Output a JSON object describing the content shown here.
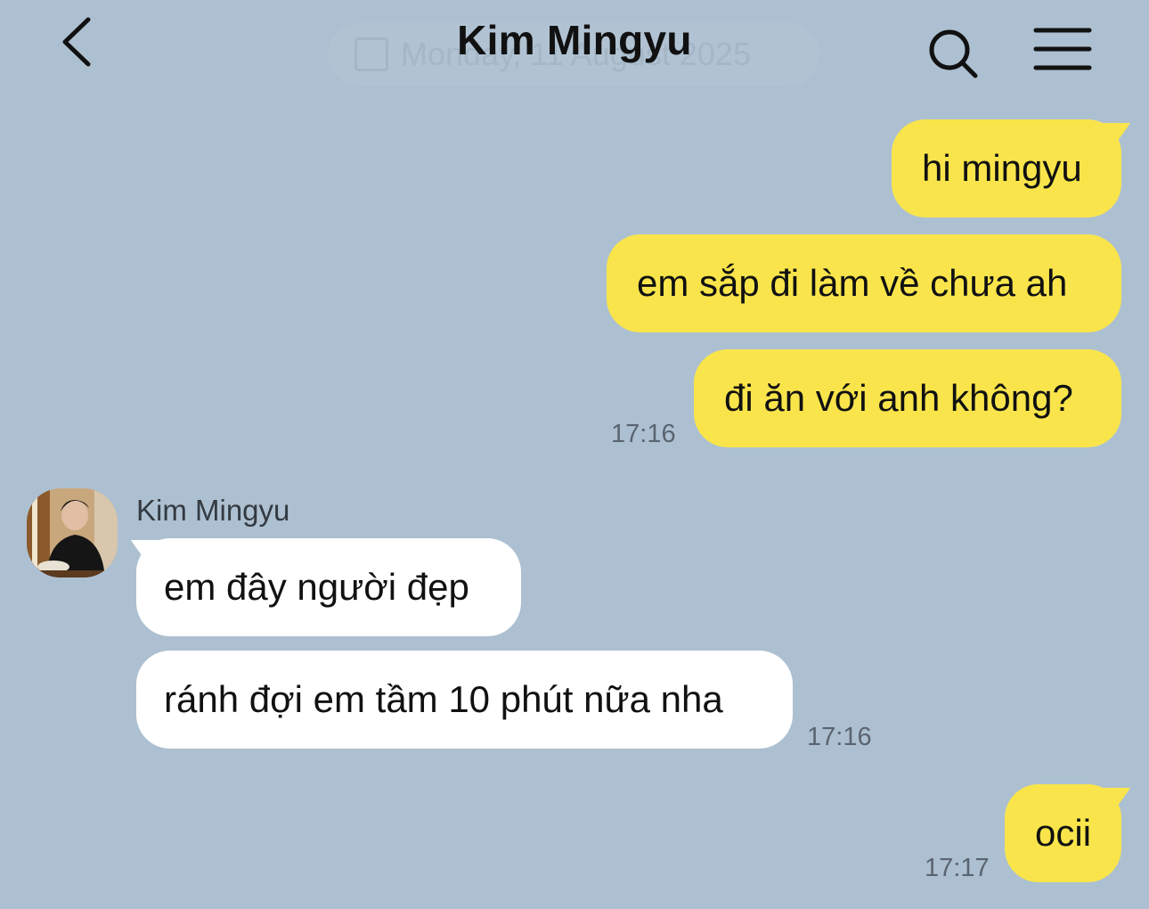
{
  "header": {
    "title": "Kim Mingyu",
    "date_pill": "Monday, 11 August 2025"
  },
  "messages": [
    {
      "text": "hi mingyu"
    },
    {
      "text": "em sắp đi làm về chưa ah"
    },
    {
      "text": "đi ăn với anh không?"
    },
    {
      "text": "em đây người đẹp"
    },
    {
      "text": "ránh đợi em tầm 10 phút nữa nha"
    },
    {
      "text": "ocii"
    }
  ],
  "times": {
    "group1": "17:16",
    "group2": "17:16",
    "group3": "17:17"
  },
  "sender": {
    "name": "Kim Mingyu"
  },
  "colors": {
    "background": "#adc0d1",
    "my_bubble": "#f9e54b",
    "their_bubble": "#ffffff"
  }
}
